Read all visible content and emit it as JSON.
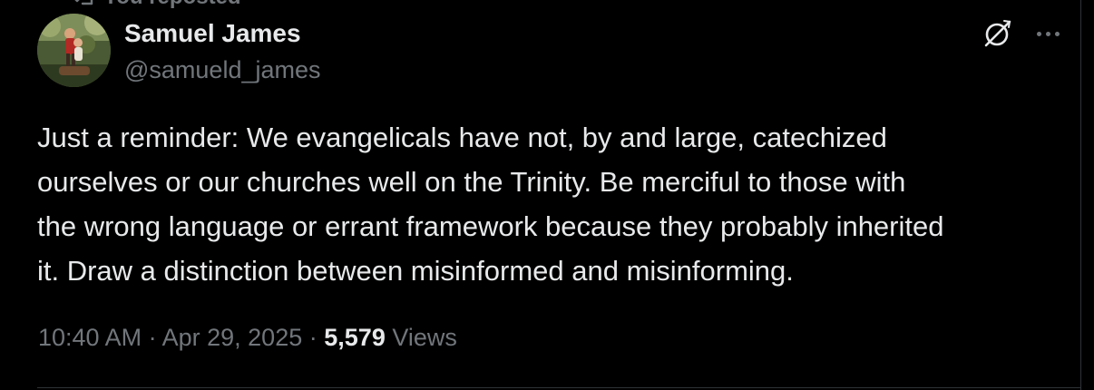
{
  "repost_banner": {
    "label": "You reposted"
  },
  "tweet": {
    "author": {
      "display_name": "Samuel James",
      "handle": "@samueld_james"
    },
    "text": "Just a reminder: We evangelicals have not, by and large, catechized\nourselves or our churches well on the Trinity. Be merciful to those with\nthe wrong language or errant framework because they probably inherited\nit. Draw a distinction between misinformed and misinforming.",
    "time": "10:40 AM",
    "separator": "·",
    "date": "Apr 29, 2025",
    "views_count": "5,579",
    "views_label": "Views"
  },
  "icons": {
    "repost": "repost-icon",
    "grok": "grok-icon",
    "more": "more-icon"
  },
  "colors": {
    "background": "#000000",
    "primary_text": "#e7e9ea",
    "secondary_text": "#71767b",
    "border": "#2f3336"
  }
}
